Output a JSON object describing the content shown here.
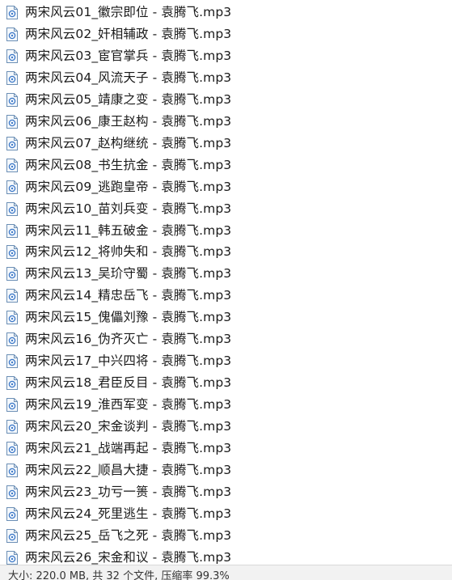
{
  "files": [
    {
      "name": "两宋风云01_徽宗即位 - 袁腾飞.mp3",
      "icon": "audio-file-icon"
    },
    {
      "name": "两宋风云02_奸相辅政 - 袁腾飞.mp3",
      "icon": "audio-file-icon"
    },
    {
      "name": "两宋风云03_宦官掌兵 - 袁腾飞.mp3",
      "icon": "audio-file-icon"
    },
    {
      "name": "两宋风云04_风流天子 - 袁腾飞.mp3",
      "icon": "audio-file-icon"
    },
    {
      "name": "两宋风云05_靖康之变 - 袁腾飞.mp3",
      "icon": "audio-file-icon"
    },
    {
      "name": "两宋风云06_康王赵构 - 袁腾飞.mp3",
      "icon": "audio-file-icon"
    },
    {
      "name": "两宋风云07_赵构继统 - 袁腾飞.mp3",
      "icon": "audio-file-icon"
    },
    {
      "name": "两宋风云08_书生抗金 - 袁腾飞.mp3",
      "icon": "audio-file-icon"
    },
    {
      "name": "两宋风云09_逃跑皇帝 - 袁腾飞.mp3",
      "icon": "audio-file-icon"
    },
    {
      "name": "两宋风云10_苗刘兵变 - 袁腾飞.mp3",
      "icon": "audio-file-icon"
    },
    {
      "name": "两宋风云11_韩五破金 - 袁腾飞.mp3",
      "icon": "audio-file-icon"
    },
    {
      "name": "两宋风云12_将帅失和 - 袁腾飞.mp3",
      "icon": "audio-file-icon"
    },
    {
      "name": "两宋风云13_吴玠守蜀 - 袁腾飞.mp3",
      "icon": "audio-file-icon"
    },
    {
      "name": "两宋风云14_精忠岳飞 - 袁腾飞.mp3",
      "icon": "audio-file-icon"
    },
    {
      "name": "两宋风云15_傀儡刘豫 - 袁腾飞.mp3",
      "icon": "audio-file-icon"
    },
    {
      "name": "两宋风云16_伪齐灭亡 - 袁腾飞.mp3",
      "icon": "audio-file-icon"
    },
    {
      "name": "两宋风云17_中兴四将 - 袁腾飞.mp3",
      "icon": "audio-file-icon"
    },
    {
      "name": "两宋风云18_君臣反目 - 袁腾飞.mp3",
      "icon": "audio-file-icon"
    },
    {
      "name": "两宋风云19_淮西军变 - 袁腾飞.mp3",
      "icon": "audio-file-icon"
    },
    {
      "name": "两宋风云20_宋金谈判 - 袁腾飞.mp3",
      "icon": "audio-file-icon"
    },
    {
      "name": "两宋风云21_战端再起 - 袁腾飞.mp3",
      "icon": "audio-file-icon"
    },
    {
      "name": "两宋风云22_顺昌大捷 - 袁腾飞.mp3",
      "icon": "audio-file-icon"
    },
    {
      "name": "两宋风云23_功亏一篑 - 袁腾飞.mp3",
      "icon": "audio-file-icon"
    },
    {
      "name": "两宋风云24_死里逃生 - 袁腾飞.mp3",
      "icon": "audio-file-icon"
    },
    {
      "name": "两宋风云25_岳飞之死 - 袁腾飞.mp3",
      "icon": "audio-file-icon"
    },
    {
      "name": "两宋风云26_宋金和议 - 袁腾飞.mp3",
      "icon": "audio-file-icon"
    }
  ],
  "status_bar": {
    "text": "大小: 220.0 MB, 共 32 个文件, 压缩率 99.3%"
  },
  "colors": {
    "icon_border": "#6c8fb5",
    "icon_fill": "#f4f8fc",
    "icon_glyph": "#3c78c8",
    "text": "#1a1a1a",
    "status_bg": "#f2f2f2"
  }
}
